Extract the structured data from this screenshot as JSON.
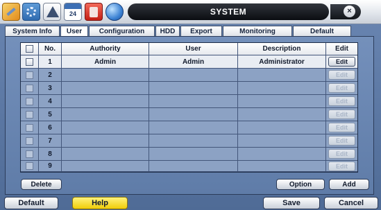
{
  "window": {
    "title": "SYSTEM",
    "close_icon": "×",
    "calendar_day": "24"
  },
  "toolbar_icons": [
    "tools-icon",
    "gear-icon",
    "alarm-icon",
    "calendar-icon",
    "record-icon",
    "network-icon"
  ],
  "tabs": [
    {
      "label": "System Info",
      "active": false
    },
    {
      "label": "User",
      "active": true
    },
    {
      "label": "Configuration",
      "active": false
    },
    {
      "label": "HDD",
      "active": false
    },
    {
      "label": "Export",
      "active": false
    },
    {
      "label": "Monitoring",
      "active": false
    },
    {
      "label": "Default",
      "active": false
    }
  ],
  "table": {
    "headers": {
      "no": "No.",
      "authority": "Authority",
      "user": "User",
      "description": "Description",
      "edit": "Edit"
    },
    "rows": [
      {
        "no": "1",
        "authority": "Admin",
        "user": "Admin",
        "description": "Administrator",
        "edit": "Edit",
        "enabled": true
      },
      {
        "no": "2",
        "authority": "",
        "user": "",
        "description": "",
        "edit": "Edit",
        "enabled": false
      },
      {
        "no": "3",
        "authority": "",
        "user": "",
        "description": "",
        "edit": "Edit",
        "enabled": false
      },
      {
        "no": "4",
        "authority": "",
        "user": "",
        "description": "",
        "edit": "Edit",
        "enabled": false
      },
      {
        "no": "5",
        "authority": "",
        "user": "",
        "description": "",
        "edit": "Edit",
        "enabled": false
      },
      {
        "no": "6",
        "authority": "",
        "user": "",
        "description": "",
        "edit": "Edit",
        "enabled": false
      },
      {
        "no": "7",
        "authority": "",
        "user": "",
        "description": "",
        "edit": "Edit",
        "enabled": false
      },
      {
        "no": "8",
        "authority": "",
        "user": "",
        "description": "",
        "edit": "Edit",
        "enabled": false
      },
      {
        "no": "9",
        "authority": "",
        "user": "",
        "description": "",
        "edit": "Edit",
        "enabled": false
      }
    ]
  },
  "panel_buttons": {
    "delete": "Delete",
    "option": "Option",
    "add": "Add"
  },
  "footer": {
    "default": "Default",
    "help": "Help",
    "save": "Save",
    "cancel": "Cancel"
  },
  "colors": {
    "background": "#5b78a5",
    "title_bar": "#0b0d11",
    "help_button": "#f0cd08"
  }
}
